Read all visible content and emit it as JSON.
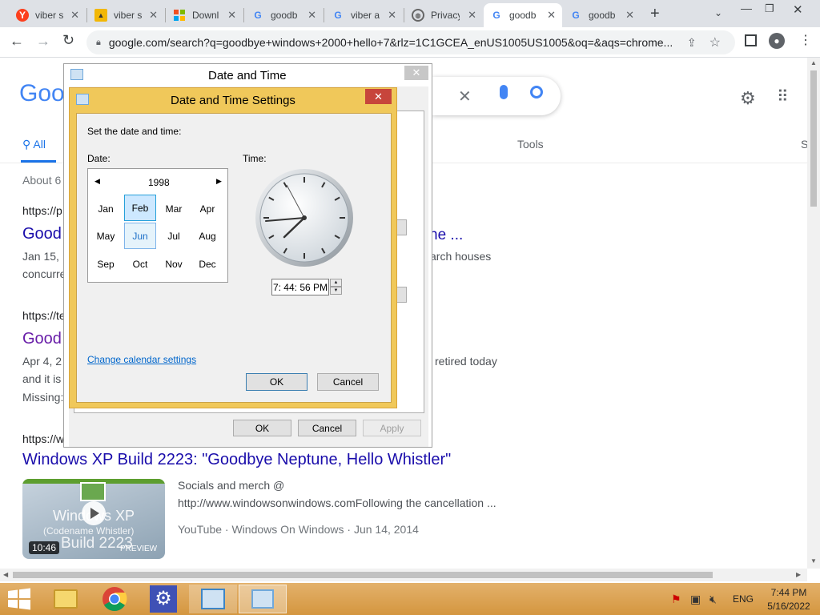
{
  "tabs": [
    {
      "title": "viber s",
      "icon": "yandex-icon"
    },
    {
      "title": "viber s",
      "icon": "image-icon"
    },
    {
      "title": "Downl",
      "icon": "microsoft-icon"
    },
    {
      "title": "goodb",
      "icon": "google-icon"
    },
    {
      "title": "viber a",
      "icon": "google-icon"
    },
    {
      "title": "Privacy",
      "icon": "globe-icon"
    },
    {
      "title": "goodb",
      "icon": "google-icon"
    },
    {
      "title": "goodb",
      "icon": "google-icon"
    }
  ],
  "browser": {
    "url": "google.com/search?q=goodbye+windows+2000+hello+7&rlz=1C1GCEA_enUS1005US1005&oq=&aqs=chrome..."
  },
  "google": {
    "logo": "Goo",
    "tab_all": "All",
    "tab_tools": "Tools",
    "tab_s": "S",
    "about": "About 6",
    "results": [
      {
        "url": "https://p",
        "title": "Good",
        "title_tail": "ne ...",
        "snip1": "Jan 15,",
        "snip1_tail": "arch houses",
        "snip2": "concurre"
      },
      {
        "url": "https://te",
        "title": "Good",
        "snip1": "Apr 4, 2",
        "snip1_tail": "retired today",
        "snip2": "and it is",
        "snip3": "Missing:"
      },
      {
        "url": "https://w",
        "title": "Windows XP Build 2223: \"Goodbye Neptune, Hello Whistler\""
      }
    ],
    "video": {
      "duration": "10:46",
      "preview": "PREVIEW",
      "thumb_line1": "Windows XP",
      "thumb_line2": "(Codename Whistler)",
      "thumb_line3": "Build 2223",
      "desc1": "Socials and merch @",
      "desc2": "http://www.windowsonwindows.comFollowing the cancellation ...",
      "meta": "YouTube · Windows On Windows · Jun 14, 2014"
    }
  },
  "outer_dialog": {
    "title": "Date and Time",
    "ok": "OK",
    "cancel": "Cancel",
    "apply": "Apply"
  },
  "dialog": {
    "title": "Date and Time Settings",
    "instruction": "Set the date and time:",
    "date_label": "Date:",
    "time_label": "Time:",
    "year": "1998",
    "months": [
      "Jan",
      "Feb",
      "Mar",
      "Apr",
      "May",
      "Jun",
      "Jul",
      "Aug",
      "Sep",
      "Oct",
      "Nov",
      "Dec"
    ],
    "selected_month": "Feb",
    "hover_month": "Jun",
    "time_value": "7: 44: 56 PM",
    "change_calendar": "Change calendar settings",
    "ok": "OK",
    "cancel": "Cancel"
  },
  "taskbar": {
    "lang": "ENG",
    "time": "7:44 PM",
    "date": "5/16/2022"
  },
  "colors": {
    "accent": "#f0c85a",
    "link": "#1a0dab",
    "taskbar": "#d9a04f"
  }
}
